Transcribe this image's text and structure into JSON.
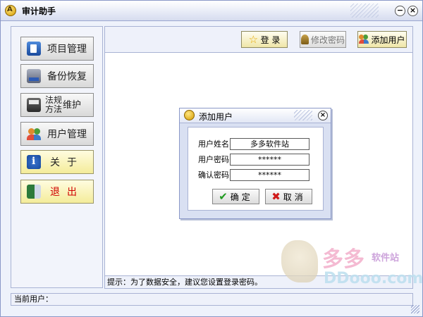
{
  "window": {
    "title": "审计助手",
    "minimize_glyph": "−",
    "close_glyph": "×"
  },
  "sidebar": {
    "items": [
      {
        "label": "项目管理",
        "icon": "project-icon"
      },
      {
        "label": "备份恢复",
        "icon": "backup-icon"
      },
      {
        "label_line1": "法规",
        "label_line2": "方法",
        "label_suffix": "维护",
        "icon": "law-icon"
      },
      {
        "label": "用户管理",
        "icon": "users-icon"
      },
      {
        "label": "关于",
        "icon": "info-icon"
      },
      {
        "label": "退出",
        "icon": "exit-icon"
      }
    ]
  },
  "toolbar": {
    "login": "登 录",
    "change_password": "修改密码",
    "add_user": "添加用户"
  },
  "hint": "提示：为了数据安全，建议您设置登录密码。",
  "status": {
    "current_user_label": "当前用户："
  },
  "dialog": {
    "title": "添加用户",
    "close_glyph": "×",
    "fields": [
      {
        "label": "用户姓名",
        "value": "多多软件站"
      },
      {
        "label": "用户密码",
        "value": "******"
      },
      {
        "label": "确认密码",
        "value": "******"
      }
    ],
    "ok": "确定",
    "cancel": "取消"
  },
  "watermark": {
    "cn": "多多",
    "cn_small": "软件站",
    "en": "DDooo.com"
  },
  "colors": {
    "accent": "#8a98c8",
    "yellow_button": "#f4ec9a",
    "exit_text": "#d00000"
  }
}
